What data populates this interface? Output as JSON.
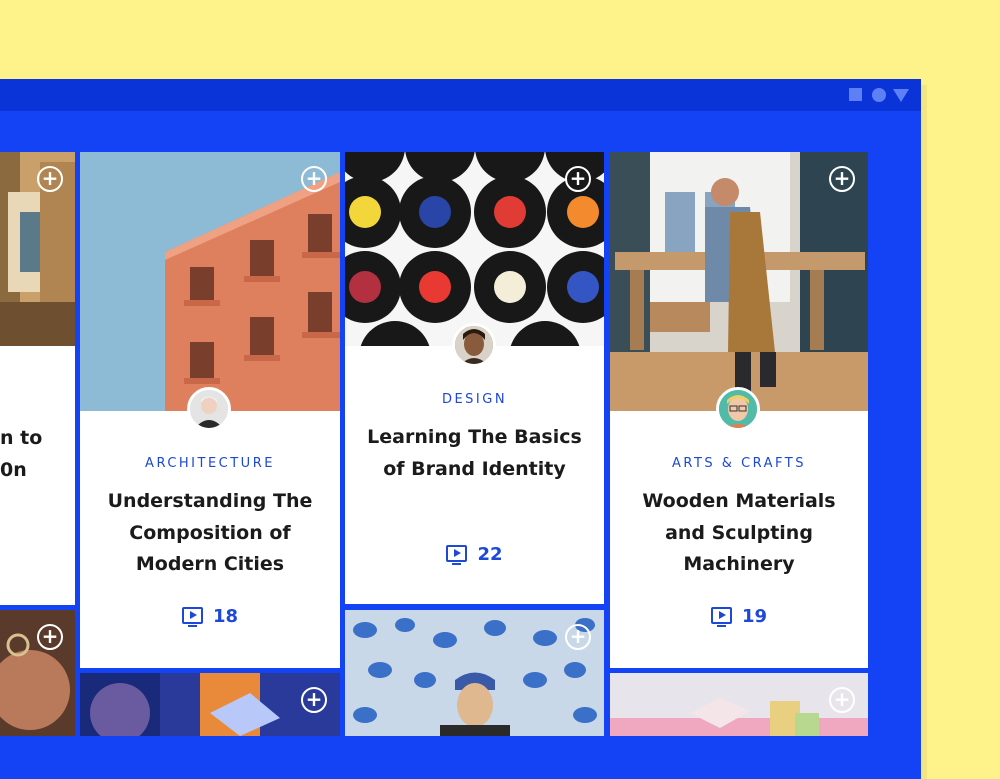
{
  "window": {
    "controls": [
      "square-icon",
      "circle-icon",
      "triangle-icon"
    ]
  },
  "cards": [
    {
      "category": "",
      "title_partial": "n to\n0n",
      "lessons": ""
    },
    {
      "category": "ARCHITECTURE",
      "title": "Understanding The Composition of Modern Cities",
      "lessons": "18"
    },
    {
      "category": "DESIGN",
      "title": "Learning The Basics of Brand Identity",
      "lessons": "22"
    },
    {
      "category": "ARTS & CRAFTS",
      "title": "Wooden Materials and Sculpting Machinery",
      "lessons": "19"
    }
  ],
  "colors": {
    "background": "#FEF38A",
    "window": "#1442F5",
    "titlebar": "#0A34D8",
    "accent": "#1D48D8"
  }
}
